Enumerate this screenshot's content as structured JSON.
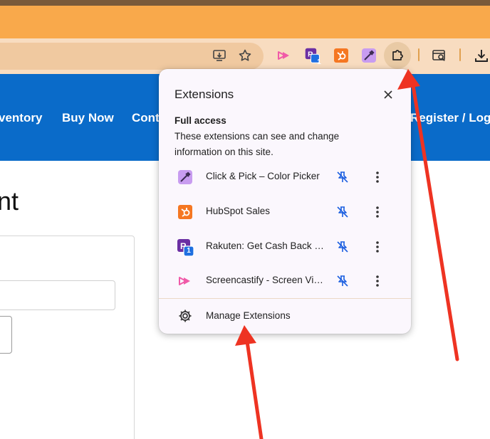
{
  "browser": {
    "toolbar_icons": [
      "install-app-icon",
      "star-icon",
      "screencastify-icon",
      "rakuten-icon",
      "hubspot-icon",
      "color-picker-icon",
      "puzzle-icon",
      "search-panel-icon",
      "download-icon"
    ],
    "rakuten_badge": "1"
  },
  "site": {
    "nav": {
      "inventory": "ventory",
      "buy_now": "Buy Now",
      "contact": "Cont",
      "register": "Register / Log"
    },
    "heading": "nt"
  },
  "extensions_popup": {
    "title": "Extensions",
    "access_heading": "Full access",
    "access_description": "These extensions can see and change information on this site.",
    "items": [
      {
        "name": "Click & Pick – Color Picker",
        "icon": "color-picker-icon"
      },
      {
        "name": "HubSpot Sales",
        "icon": "hubspot-icon"
      },
      {
        "name": "Rakuten: Get Cash Back For Shopping",
        "icon": "rakuten-icon",
        "badge": "1"
      },
      {
        "name": "Screencastify - Screen Video Recorder",
        "icon": "screencastify-icon"
      }
    ],
    "manage_label": "Manage Extensions"
  },
  "colors": {
    "tab_bar": "#f9a94b",
    "toolbar": "#f8dcc0",
    "site_nav": "#0a6bc9",
    "popup_bg": "#fbf7fd",
    "annotation_arrow": "#ee3322"
  }
}
